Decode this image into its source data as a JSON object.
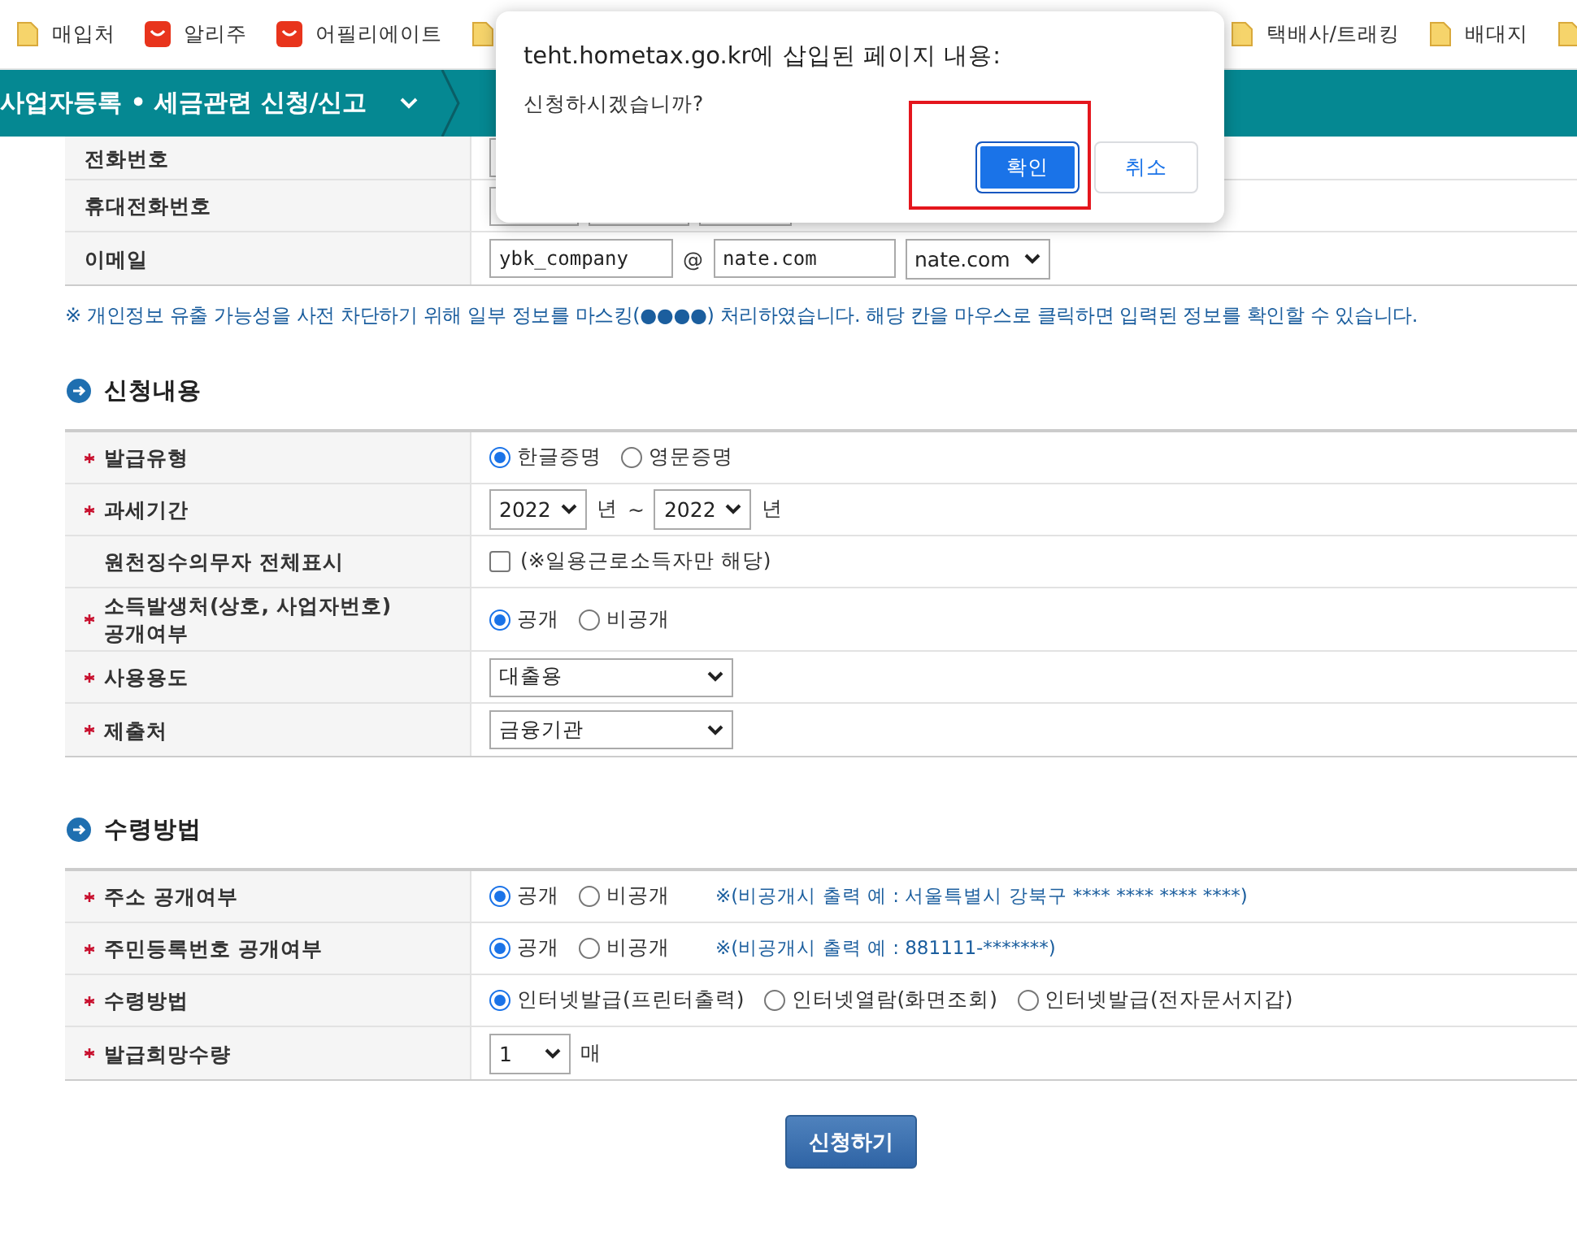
{
  "bookmarks_left": [
    {
      "kind": "folder",
      "label": "매입처"
    },
    {
      "kind": "shop",
      "label": "알리주"
    },
    {
      "kind": "shop",
      "label": "어필리에이트"
    },
    {
      "kind": "folder"
    }
  ],
  "bookmarks_right": [
    {
      "kind": "folder",
      "label": "택배사/트래킹"
    },
    {
      "kind": "folder",
      "label": "배대지"
    },
    {
      "kind": "folder"
    }
  ],
  "nav": {
    "title": "사업자등록 • 세금관련 신청/신고"
  },
  "contact_rows": [
    {
      "label": "전화번호",
      "kind": "phone_partial"
    },
    {
      "label": "휴대전화번호",
      "kind": "phone"
    },
    {
      "label": "이메일",
      "kind": "email",
      "user": "ybk_company",
      "at": "@",
      "domain": "nate.com",
      "domain_select": "nate.com"
    }
  ],
  "notice": "※ 개인정보 유출 가능성을 사전 차단하기 위해 일부 정보를 마스킹(●●●●) 처리하였습니다. 해당 칸을 마우스로 클릭하면 입력된 정보를 확인할 수 있습니다.",
  "sections": [
    {
      "title": "신청내용",
      "rows": [
        {
          "label": "발급유형",
          "required": true,
          "kind": "radio",
          "options": [
            {
              "label": "한글증명",
              "selected": true
            },
            {
              "label": "영문증명",
              "selected": false
            }
          ]
        },
        {
          "label": "과세기간",
          "required": true,
          "kind": "year_range",
          "from": "2022",
          "from_unit": "년",
          "separator": "~",
          "to": "2022",
          "to_unit": "년"
        },
        {
          "label": "원천징수의무자 전체표시",
          "required": false,
          "kind": "checkbox",
          "checked": false,
          "text": "(※일용근로소득자만 해당)"
        },
        {
          "label": "소득발생처(상호, 사업자번호) 공개여부",
          "required": true,
          "kind": "radio",
          "options": [
            {
              "label": "공개",
              "selected": true
            },
            {
              "label": "비공개",
              "selected": false
            }
          ]
        },
        {
          "label": "사용용도",
          "required": true,
          "kind": "select",
          "value": "대출용"
        },
        {
          "label": "제출처",
          "required": true,
          "kind": "select",
          "value": "금융기관"
        }
      ]
    },
    {
      "title": "수령방법",
      "rows": [
        {
          "label": "주소 공개여부",
          "required": true,
          "kind": "radio",
          "options": [
            {
              "label": "공개",
              "selected": true
            },
            {
              "label": "비공개",
              "selected": false
            }
          ],
          "note": "※(비공개시 출력 예 : 서울특별시 강북구 **** **** **** ****)"
        },
        {
          "label": "주민등록번호 공개여부",
          "required": true,
          "kind": "radio",
          "options": [
            {
              "label": "공개",
              "selected": true
            },
            {
              "label": "비공개",
              "selected": false
            }
          ],
          "note": "※(비공개시 출력 예 : 881111-*******)"
        },
        {
          "label": "수령방법",
          "required": true,
          "kind": "radio",
          "options": [
            {
              "label": "인터넷발급(프린터출력)",
              "selected": true
            },
            {
              "label": "인터넷열람(화면조회)",
              "selected": false
            },
            {
              "label": "인터넷발급(전자문서지갑)",
              "selected": false
            }
          ]
        },
        {
          "label": "발급희망수량",
          "required": true,
          "kind": "quantity",
          "value": "1",
          "unit": "매"
        }
      ]
    }
  ],
  "submit": "신청하기",
  "dialog": {
    "title": "teht.hometax.go.kr에 삽입된 페이지 내용:",
    "message": "신청하시겠습니까?",
    "buttons": [
      {
        "label": "확인",
        "primary": true
      },
      {
        "label": "취소",
        "primary": false
      }
    ]
  },
  "annotation": {
    "kind": "red_frame"
  }
}
